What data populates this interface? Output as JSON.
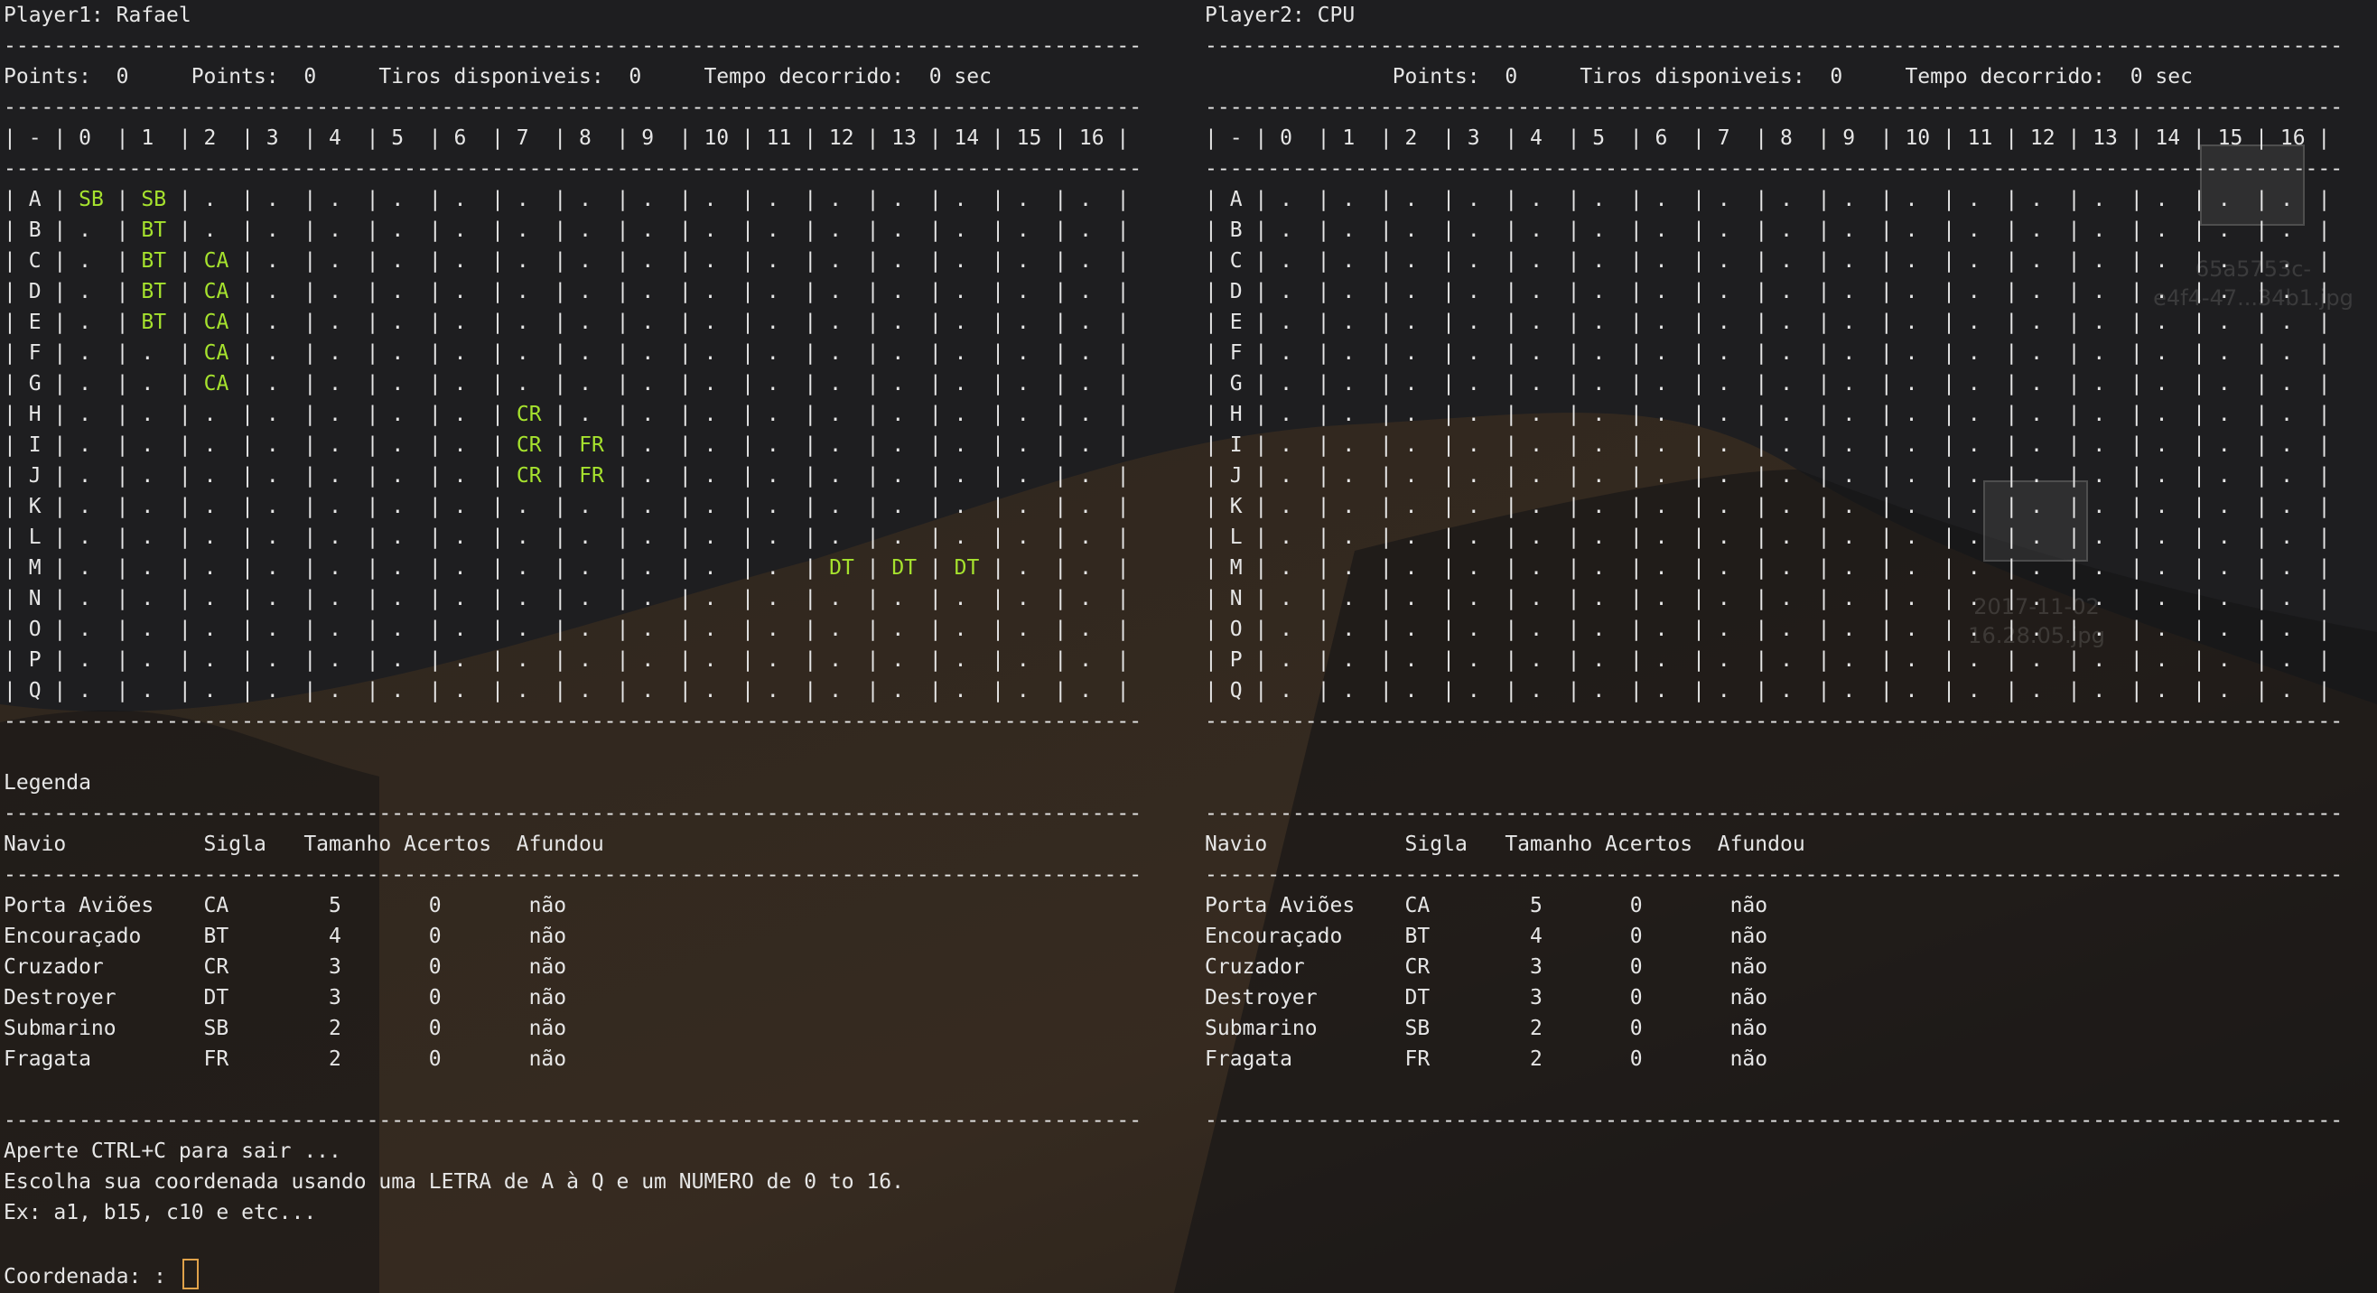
{
  "left": {
    "title": "Player1: Rafael",
    "stats": "Points:  0     Points:  0     Tiros disponiveis:  0     Tempo decorrido:  0 sec",
    "col_header": "| - | 0  | 1  | 2  | 3  | 4  | 5  | 6  | 7  | 8  | 9  | 10 | 11 | 12 | 13 | 14 | 15 | 16 |",
    "row_labels": [
      "A",
      "B",
      "C",
      "D",
      "E",
      "F",
      "G",
      "H",
      "I",
      "J",
      "K",
      "L",
      "M",
      "N",
      "O",
      "P",
      "Q"
    ],
    "ships": [
      {
        "row": "A",
        "col": 0,
        "code": "SB"
      },
      {
        "row": "A",
        "col": 1,
        "code": "SB"
      },
      {
        "row": "B",
        "col": 1,
        "code": "BT"
      },
      {
        "row": "C",
        "col": 1,
        "code": "BT"
      },
      {
        "row": "D",
        "col": 1,
        "code": "BT"
      },
      {
        "row": "E",
        "col": 1,
        "code": "BT"
      },
      {
        "row": "C",
        "col": 2,
        "code": "CA"
      },
      {
        "row": "D",
        "col": 2,
        "code": "CA"
      },
      {
        "row": "E",
        "col": 2,
        "code": "CA"
      },
      {
        "row": "F",
        "col": 2,
        "code": "CA"
      },
      {
        "row": "G",
        "col": 2,
        "code": "CA"
      },
      {
        "row": "H",
        "col": 7,
        "code": "CR"
      },
      {
        "row": "I",
        "col": 7,
        "code": "CR"
      },
      {
        "row": "J",
        "col": 7,
        "code": "CR"
      },
      {
        "row": "I",
        "col": 8,
        "code": "FR"
      },
      {
        "row": "J",
        "col": 8,
        "code": "FR"
      },
      {
        "row": "M",
        "col": 12,
        "code": "DT"
      },
      {
        "row": "M",
        "col": 13,
        "code": "DT"
      },
      {
        "row": "M",
        "col": 14,
        "code": "DT"
      }
    ],
    "legend_title": "Legenda",
    "table_header": "Navio           Sigla   Tamanho Acertos  Afundou",
    "table_rows": [
      "Porta Aviões    CA        5       0       não",
      "Encouraçado     BT        4       0       não",
      "Cruzador        CR        3       0       não",
      "Destroyer       DT        3       0       não",
      "Submarino       SB        2       0       não",
      "Fragata         FR        2       0       não"
    ],
    "footer_lines": [
      "Aperte CTRL+C para sair ...",
      "Escolha sua coordenada usando uma LETRA de A à Q e um NUMERO de 0 to 16.",
      "Ex: a1, b15, c10 e etc..."
    ],
    "prompt": "Coordenada: : "
  },
  "right": {
    "title": "Player2: CPU",
    "stats": "               Points:  0     Tiros disponiveis:  0     Tempo decorrido:  0 sec",
    "col_header": "| - | 0  | 1  | 2  | 3  | 4  | 5  | 6  | 7  | 8  | 9  | 10 | 11 | 12 | 13 | 14 | 15 | 16 |",
    "table_header": "Navio           Sigla   Tamanho Acertos  Afundou",
    "table_rows": [
      "Porta Aviões    CA        5       0       não",
      "Encouraçado     BT        4       0       não",
      "Cruzador        CR        3       0       não",
      "Destroyer       DT        3       0       não",
      "Submarino       SB        2       0       não",
      "Fragata         FR        2       0       não"
    ]
  },
  "desktop": {
    "file1": "65a5753c-\ne4f4-47...34b1.jpg",
    "file2": "2017-11-02\n16.28.05.jpg"
  },
  "colors": {
    "ship": "#a6e22e",
    "cursor": "#e0a24a",
    "text": "#e6e6e6"
  }
}
